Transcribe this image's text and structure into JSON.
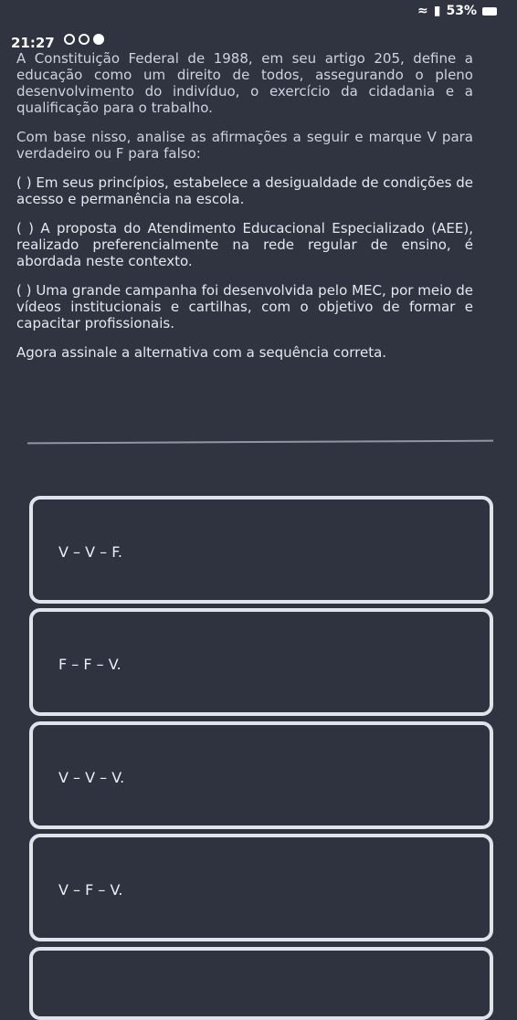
{
  "status": {
    "time": "21:27",
    "battery": "53%"
  },
  "question": {
    "intro": "A Constituição Federal de 1988, em seu artigo 205, define a educação como um direito de todos, assegurando o pleno desenvolvimento do indivíduo, o exercício da cidadania e a qualificação para o trabalho.",
    "instruction": "Com base nisso, analise as afirmações a seguir e marque V para verdadeiro ou F para falso:",
    "statement1": "( ) Em seus princípios, estabelece a desigualdade de condições de acesso e permanência na escola.",
    "statement2": "( ) A proposta do Atendimento Educacional Especializado (AEE), realizado preferencialmente na rede regular de ensino, é abordada neste contexto.",
    "statement3": "( ) Uma grande campanha foi desenvolvida pelo MEC, por meio de vídeos institucionais e cartilhas, com o objetivo de formar e capacitar profissionais.",
    "prompt": "Agora assinale a alternativa com a sequência correta."
  },
  "options": [
    "V – V – F.",
    "F – F – V.",
    "V – V – V.",
    "V – F – V."
  ]
}
